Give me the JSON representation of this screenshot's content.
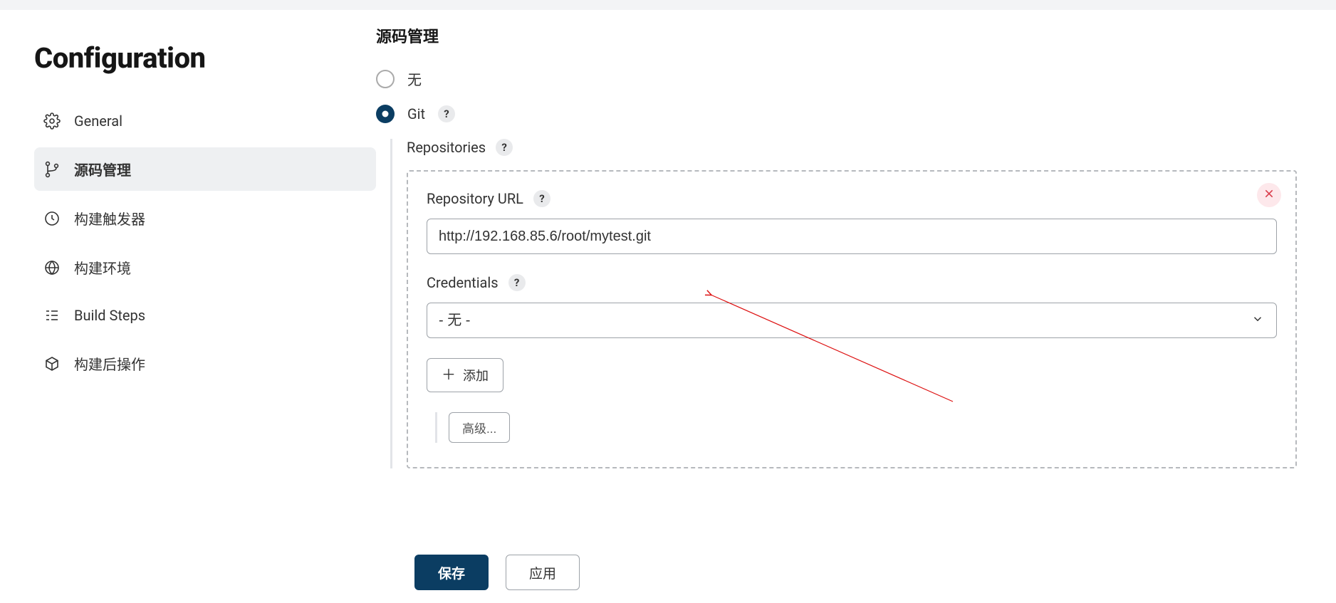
{
  "sidebar": {
    "title": "Configuration",
    "items": [
      {
        "id": "general",
        "label": "General"
      },
      {
        "id": "scm",
        "label": "源码管理"
      },
      {
        "id": "triggers",
        "label": "构建触发器"
      },
      {
        "id": "env",
        "label": "构建环境"
      },
      {
        "id": "build-steps",
        "label": "Build Steps"
      },
      {
        "id": "post-build",
        "label": "构建后操作"
      }
    ]
  },
  "main": {
    "section_title": "源码管理",
    "option_none_label": "无",
    "option_git_label": "Git",
    "repositories_label": "Repositories",
    "repository_url_label": "Repository URL",
    "repository_url_value": "http://192.168.85.6/root/mytest.git",
    "credentials_label": "Credentials",
    "credentials_selected": "- 无 -",
    "add_label": "添加",
    "advanced_label": "高级..."
  },
  "footer": {
    "save_label": "保存",
    "apply_label": "应用"
  }
}
